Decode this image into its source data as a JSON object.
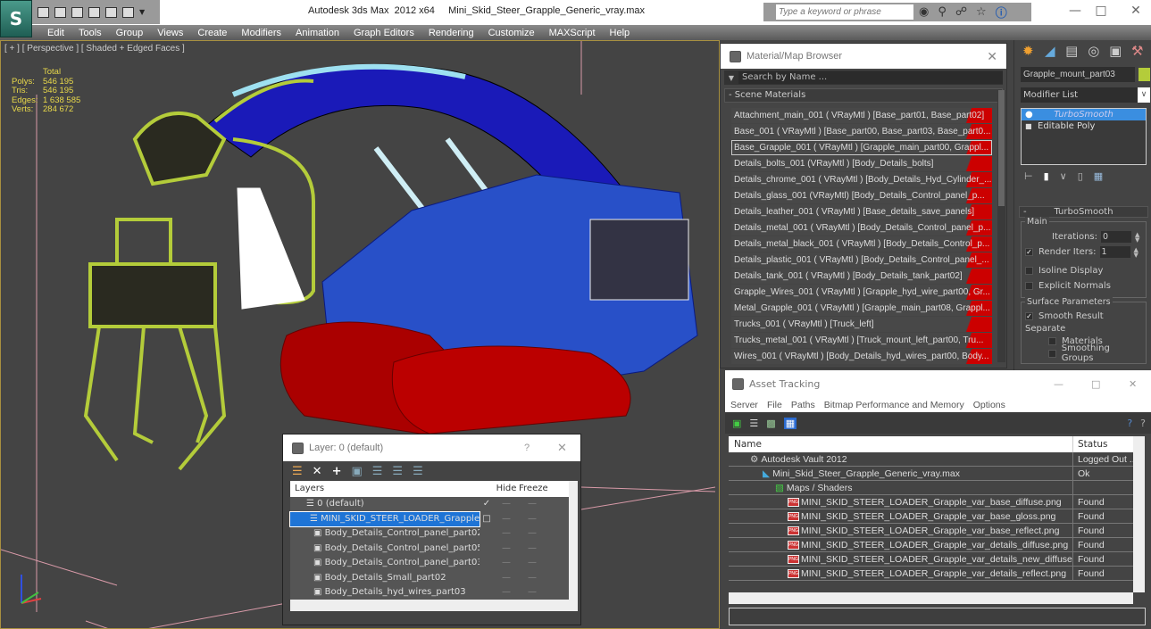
{
  "app": {
    "title": "Autodesk 3ds Max  2012 x64     Mini_Skid_Steer_Grapple_Generic_vray.max",
    "logo_icon": "3dsmax-logo-icon",
    "quick_access": [
      "open-icon",
      "save-icon",
      "new-icon",
      "hold-icon",
      "undo-icon",
      "redo-icon",
      "dropdown-icon"
    ],
    "search_placeholder": "Type a keyword or phrase",
    "search_tools": [
      "binoculars-icon",
      "wrench-icon",
      "satellite-icon",
      "star-icon",
      "help-icon"
    ],
    "window_controls": {
      "minimize": "—",
      "maximize": "□",
      "close": "✕"
    }
  },
  "menu": [
    "Edit",
    "Tools",
    "Group",
    "Views",
    "Create",
    "Modifiers",
    "Animation",
    "Graph Editors",
    "Rendering",
    "Customize",
    "MAXScript",
    "Help"
  ],
  "viewport": {
    "label": "[ + ] [ Perspective ] [ Shaded + Edged Faces ]",
    "stats_header": "Total",
    "stats": [
      {
        "k": "Polys:",
        "v": "546 195"
      },
      {
        "k": "Tris:",
        "v": "546 195"
      },
      {
        "k": "Edges:",
        "v": "1 638 585"
      },
      {
        "k": "Verts:",
        "v": "284 672"
      }
    ]
  },
  "material_browser": {
    "title": "Material/Map Browser",
    "search_placeholder": "Search by Name ...",
    "section": "- Scene Materials",
    "items": [
      "Attachment_main_001  ( VRayMtl )  [Base_part01, Base_part02]",
      "Base_001  ( VRayMtl )  [Base_part00, Base_part03, Base_part0...",
      "Base_Grapple_001  ( VRayMtl )  [Grapple_main_part00, Grappl...",
      "Details_bolts_001  (VRayMtl )  [Body_Details_bolts]",
      "Details_chrome_001  ( VRayMtl )  [Body_Details_Hyd_Cylinder_...",
      "Details_glass_001 (VRayMtl) [Body_Details_Control_panel_p...",
      "Details_leather_001  ( VRayMtl )  [Base_details_save_panels]",
      "Details_metal_001  ( VRayMtl )  [Body_Details_Control_panel_p...",
      "Details_metal_black_001  ( VRayMtl )  [Body_Details_Control_p...",
      "Details_plastic_001  ( VRayMtl )  [Body_Details_Control_panel_...",
      "Details_tank_001  ( VRayMtl )  [Body_Details_tank_part02]",
      "Grapple_Wires_001  ( VRayMtl )  [Grapple_hyd_wire_part00, Gr...",
      "Metal_Grapple_001  ( VRayMtl )  [Grapple_main_part08, Grappl...",
      "Trucks_001  ( VRayMtl )  [Truck_left]",
      "Trucks_metal_001   ( VRayMtl )  [Truck_mount_left_part00, Tru...",
      "Wires_001  ( VRayMtl )  [Body_Details_hyd_wires_part00, Body..."
    ],
    "selected_index": 2
  },
  "command_panel": {
    "tabs": [
      "create-icon",
      "modify-icon",
      "hierarchy-icon",
      "motion-icon",
      "display-icon",
      "utilities-icon"
    ],
    "object_name": "Grapple_mount_part03",
    "object_color": "#b4cc3a",
    "modifier_list": "Modifier List",
    "stack": [
      {
        "label": "TurboSmooth",
        "selected": true
      },
      {
        "label": "Editable Poly",
        "selected": false
      }
    ],
    "rollout_title": "TurboSmooth",
    "main_group": "Main",
    "iterations_label": "Iterations:",
    "iterations": "0",
    "render_iters_label": "Render Iters:",
    "render_iters": "1",
    "render_iters_checked": true,
    "isoline_label": "Isoline Display",
    "isoline_checked": false,
    "explicit_label": "Explicit Normals",
    "explicit_checked": false,
    "surface_group": "Surface Parameters",
    "smooth_result_label": "Smooth Result",
    "smooth_result_checked": true,
    "separate_label": "Separate",
    "materials_label": "Materials",
    "smoothing_groups_label": "Smoothing Groups"
  },
  "asset_tracking": {
    "title": "Asset Tracking",
    "menu": [
      "Server",
      "File",
      "Paths",
      "Bitmap Performance and Memory",
      "Options"
    ],
    "col_name": "Name",
    "col_status": "Status",
    "rows": [
      {
        "indent": 1,
        "icon": "vault-icon",
        "name": "Autodesk Vault 2012",
        "status": "Logged Out ..."
      },
      {
        "indent": 2,
        "icon": "max-file-icon",
        "name": "Mini_Skid_Steer_Grapple_Generic_vray.max",
        "status": "Ok"
      },
      {
        "indent": 3,
        "icon": "maps-icon",
        "name": "Maps / Shaders",
        "status": ""
      },
      {
        "indent": 4,
        "icon": "png-icon",
        "name": "MINI_SKID_STEER_LOADER_Grapple_var_base_diffuse.png",
        "status": "Found"
      },
      {
        "indent": 4,
        "icon": "png-icon",
        "name": "MINI_SKID_STEER_LOADER_Grapple_var_base_gloss.png",
        "status": "Found"
      },
      {
        "indent": 4,
        "icon": "png-icon",
        "name": "MINI_SKID_STEER_LOADER_Grapple_var_base_reflect.png",
        "status": "Found"
      },
      {
        "indent": 4,
        "icon": "png-icon",
        "name": "MINI_SKID_STEER_LOADER_Grapple_var_details_diffuse.png",
        "status": "Found"
      },
      {
        "indent": 4,
        "icon": "png-icon",
        "name": "MINI_SKID_STEER_LOADER_Grapple_var_details_new_diffuse.png",
        "status": "Found"
      },
      {
        "indent": 4,
        "icon": "png-icon",
        "name": "MINI_SKID_STEER_LOADER_Grapple_var_details_reflect.png",
        "status": "Found"
      }
    ]
  },
  "layer_dialog": {
    "title": "Layer: 0 (default)",
    "help": "?",
    "close": "✕",
    "col_layers": "Layers",
    "col_hide": "Hide",
    "col_freeze": "Freeze",
    "rows": [
      {
        "indent": 1,
        "name": "0 (default)",
        "current": "✓",
        "selected": false
      },
      {
        "indent": 1,
        "name": "MINI_SKID_STEER_LOADER_Grapple_var",
        "current": "□",
        "selected": true
      },
      {
        "indent": 2,
        "name": "Body_Details_Control_panel_part02",
        "current": "",
        "selected": false
      },
      {
        "indent": 2,
        "name": "Body_Details_Control_panel_part05",
        "current": "",
        "selected": false
      },
      {
        "indent": 2,
        "name": "Body_Details_Control_panel_part03",
        "current": "",
        "selected": false
      },
      {
        "indent": 2,
        "name": "Body_Details_Small_part02",
        "current": "",
        "selected": false
      },
      {
        "indent": 2,
        "name": "Body_Details_hyd_wires_part03",
        "current": "",
        "selected": false
      }
    ],
    "hide_mark": "—",
    "freeze_mark": "—"
  }
}
